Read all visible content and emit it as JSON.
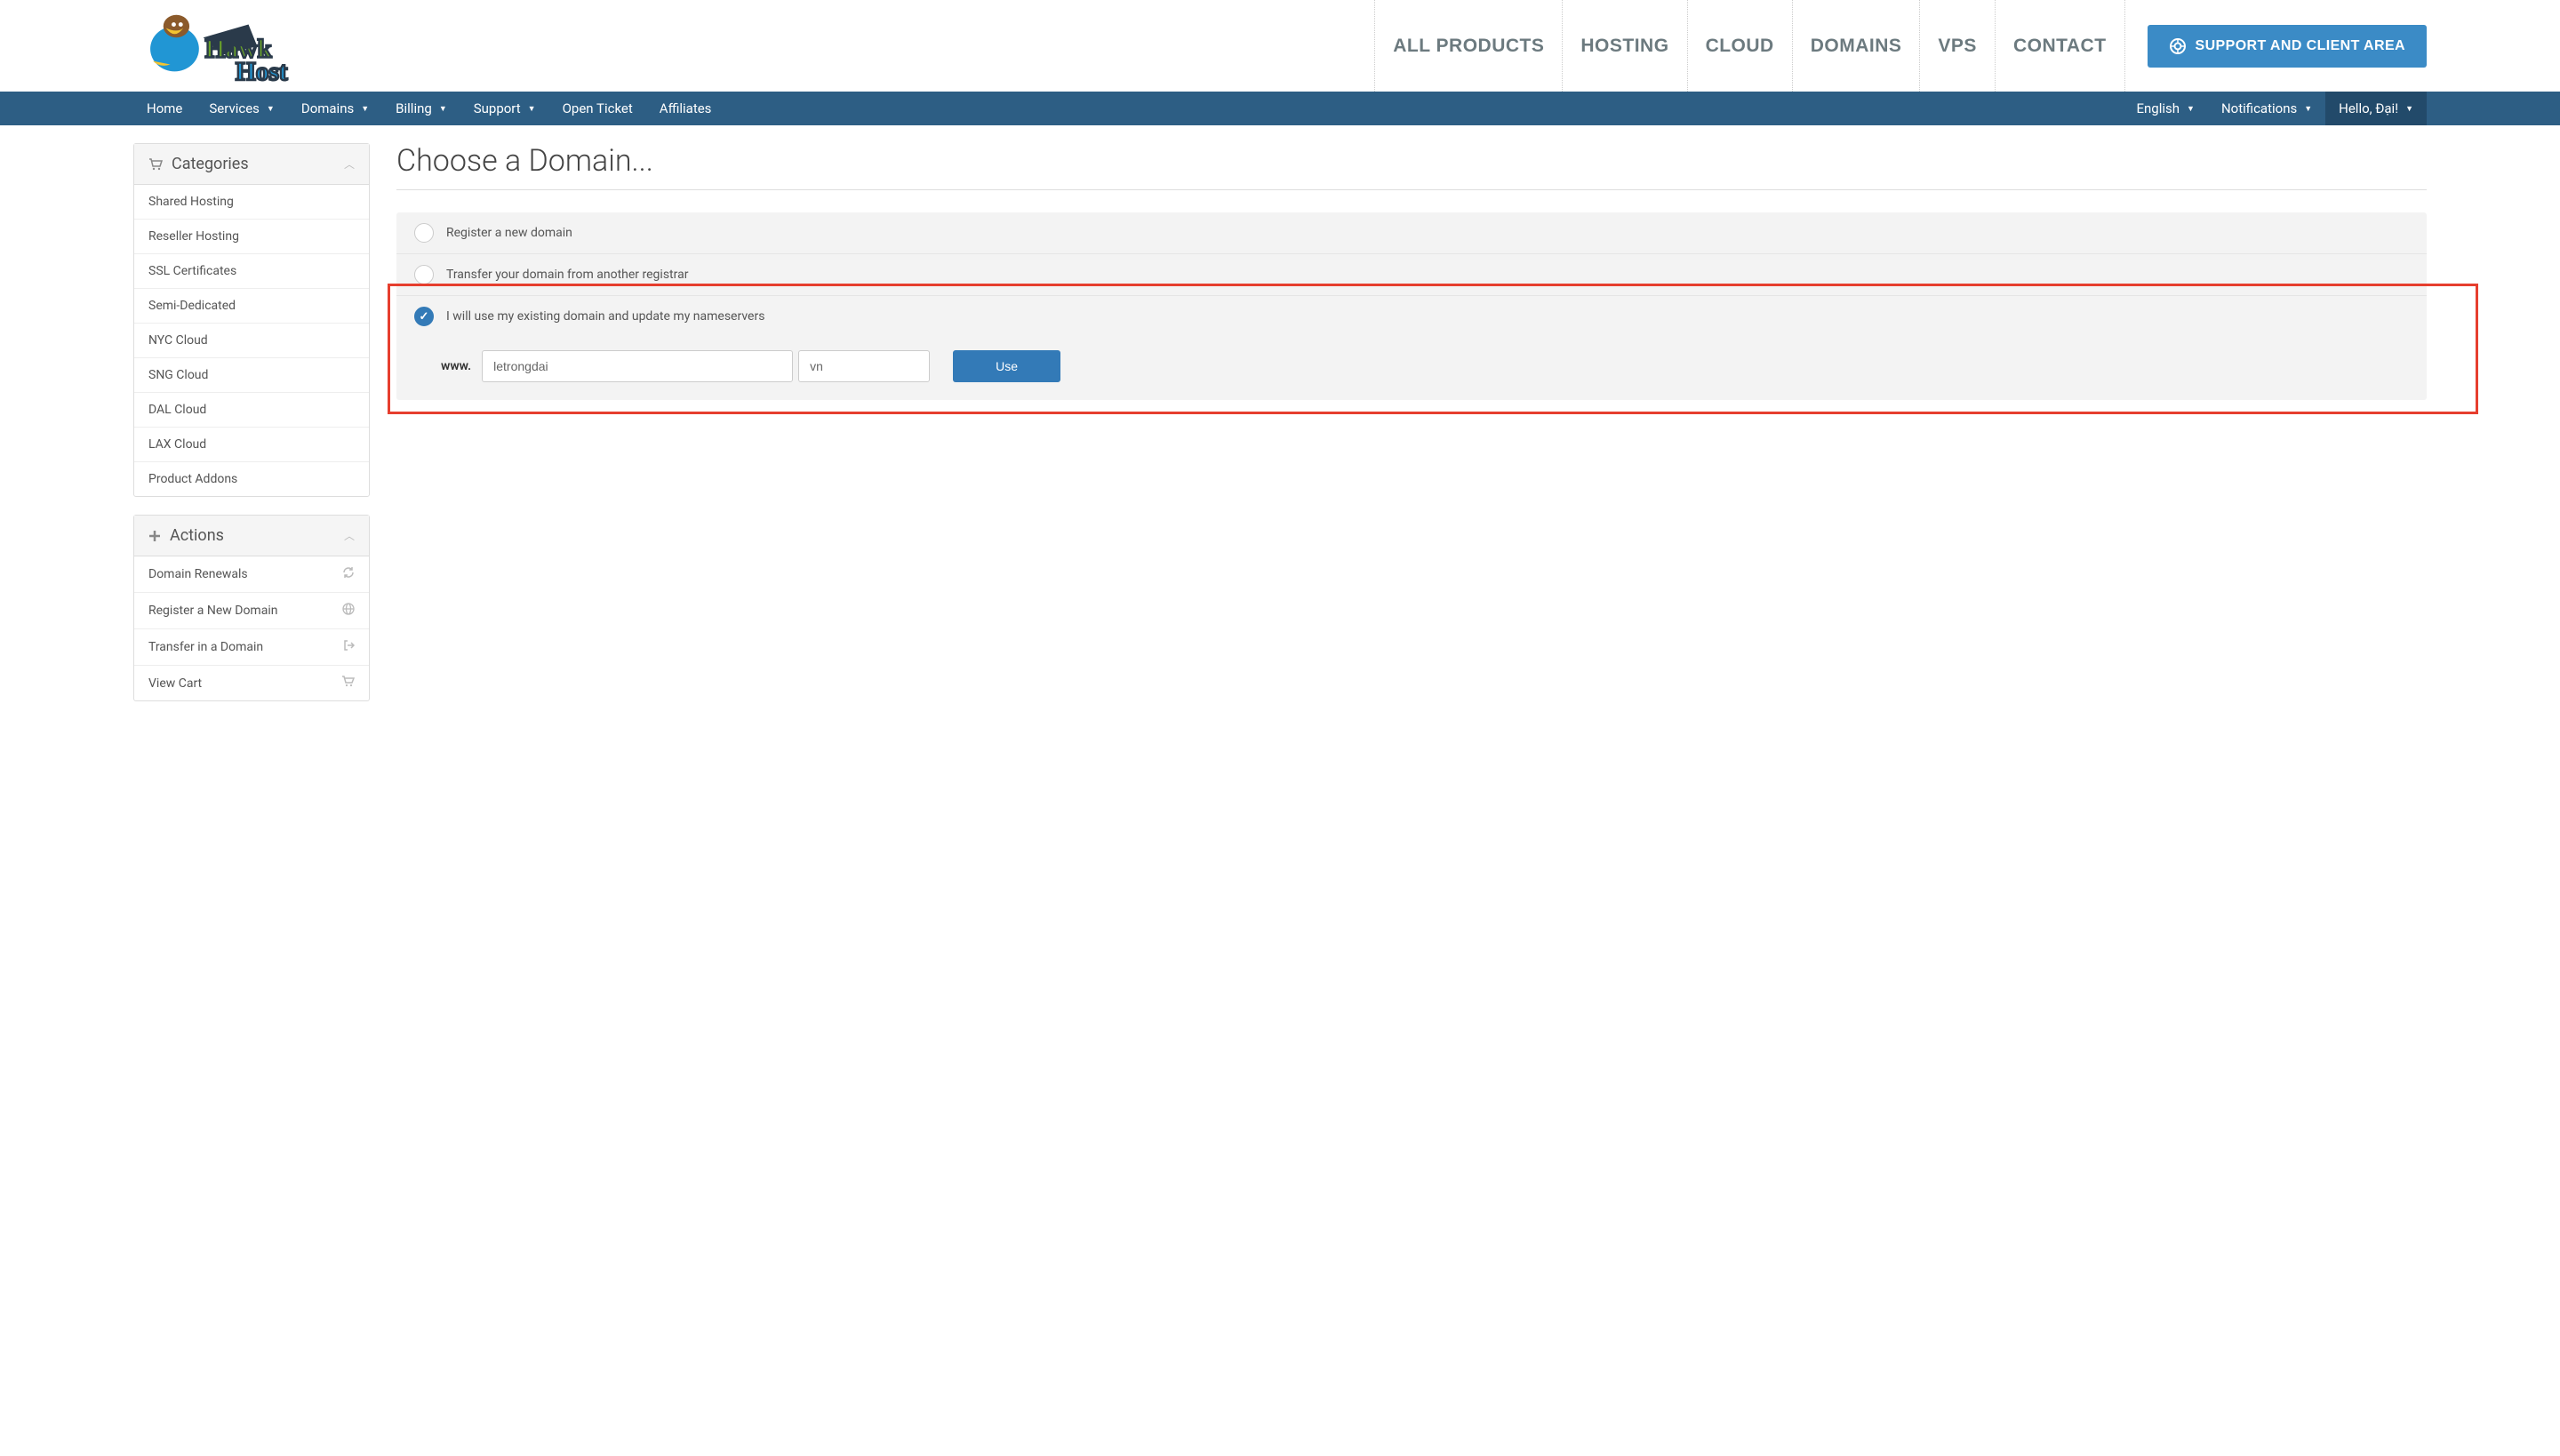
{
  "top_nav": {
    "items": [
      "ALL PRODUCTS",
      "HOSTING",
      "CLOUD",
      "DOMAINS",
      "VPS",
      "CONTACT"
    ],
    "support_button": "SUPPORT AND CLIENT AREA"
  },
  "sec_nav": {
    "left": [
      {
        "label": "Home",
        "caret": false
      },
      {
        "label": "Services",
        "caret": true
      },
      {
        "label": "Domains",
        "caret": true
      },
      {
        "label": "Billing",
        "caret": true
      },
      {
        "label": "Support",
        "caret": true
      },
      {
        "label": "Open Ticket",
        "caret": false
      },
      {
        "label": "Affiliates",
        "caret": false
      }
    ],
    "right": [
      {
        "label": "English",
        "caret": true,
        "active": false
      },
      {
        "label": "Notifications",
        "caret": true,
        "active": false
      },
      {
        "label": "Hello, Đại!",
        "caret": true,
        "active": true
      }
    ]
  },
  "sidebar": {
    "categories": {
      "title": "Categories",
      "items": [
        "Shared Hosting",
        "Reseller Hosting",
        "SSL Certificates",
        "Semi-Dedicated",
        "NYC Cloud",
        "SNG Cloud",
        "DAL Cloud",
        "LAX Cloud",
        "Product Addons"
      ]
    },
    "actions": {
      "title": "Actions",
      "items": [
        {
          "label": "Domain Renewals",
          "icon": "refresh"
        },
        {
          "label": "Register a New Domain",
          "icon": "globe"
        },
        {
          "label": "Transfer in a Domain",
          "icon": "share"
        },
        {
          "label": "View Cart",
          "icon": "cart"
        }
      ]
    }
  },
  "main": {
    "title": "Choose a Domain...",
    "options": [
      {
        "label": "Register a new domain",
        "checked": false
      },
      {
        "label": "Transfer your domain from another registrar",
        "checked": false
      },
      {
        "label": "I will use my existing domain and update my nameservers",
        "checked": true
      }
    ],
    "form": {
      "www": "www.",
      "domain_value": "letrongdai",
      "tld_value": "vn",
      "use_button": "Use"
    }
  }
}
